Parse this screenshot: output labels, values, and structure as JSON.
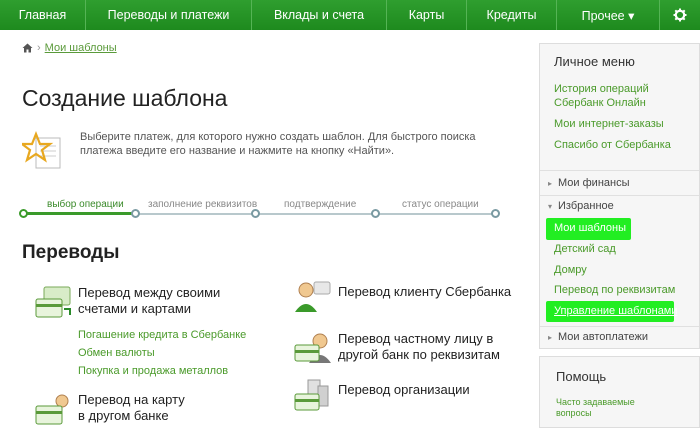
{
  "nav": {
    "items": [
      "Главная",
      "Переводы и платежи",
      "Вклады и счета",
      "Карты",
      "Кредиты",
      "Прочее ▾"
    ],
    "gear_icon": "gear-icon"
  },
  "breadcrumb": {
    "current": "Мои шаблоны",
    "home_icon": "home-icon"
  },
  "page": {
    "title": "Создание шаблона",
    "intro": "Выберите платеж, для которого нужно создать шаблон. Для быстрого поиска платежа введите его название и нажмите на кнопку «Найти»."
  },
  "steps": {
    "labels": [
      "выбор операции",
      "заполнение реквизитов",
      "подтверждение",
      "статус операции"
    ],
    "active_index": 0
  },
  "transfers": {
    "title": "Переводы",
    "own_accounts": "Перевод между своими счетами и картами",
    "sublinks": [
      "Погашение кредита в Сбербанке",
      "Обмен валюты",
      "Покупка и продажа металлов"
    ],
    "card_other_bank": "Перевод на карту в другом банке",
    "client_sber": "Перевод клиенту Сбербанка",
    "private_other_bank": "Перевод частному лицу в другой банк по реквизитам",
    "organization": "Перевод организации"
  },
  "sidebar": {
    "title": "Личное меню",
    "links": [
      "История операций Сбербанк Онлайн",
      "Мои интернет-заказы",
      "Спасибо от Сбербанка"
    ],
    "finances": "Мои финансы",
    "favorites": "Избранное",
    "fav_items": [
      "Мои шаблоны",
      "Детский сад",
      "Домру",
      "Перевод по реквизитам",
      "Управление шаблонами"
    ],
    "autopay": "Мои автоплатежи"
  },
  "help": {
    "title": "Помощь",
    "faq": "Часто задаваемые вопросы"
  },
  "colors": {
    "brand_green": "#1e8a1e",
    "link_green": "#4a9a2a",
    "highlight": "#22ee22"
  }
}
